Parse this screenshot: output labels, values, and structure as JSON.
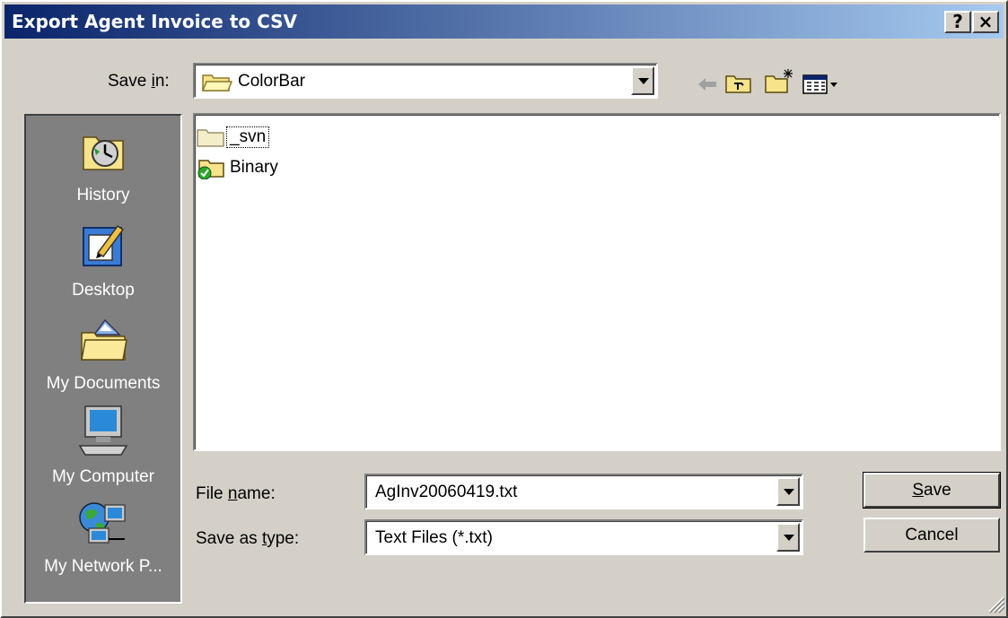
{
  "window": {
    "title": "Export Agent Invoice to CSV",
    "help_glyph": "?",
    "close_glyph": "×"
  },
  "save_in": {
    "label": "Save in:",
    "value": "ColorBar"
  },
  "places": [
    {
      "label": "History",
      "icon": "history-icon"
    },
    {
      "label": "Desktop",
      "icon": "desktop-icon"
    },
    {
      "label": "My Documents",
      "icon": "my-documents-icon"
    },
    {
      "label": "My Computer",
      "icon": "my-computer-icon"
    },
    {
      "label": "My Network P...",
      "icon": "my-network-places-icon"
    }
  ],
  "files": [
    {
      "name": "_svn",
      "icon": "folder-icon",
      "focused": true
    },
    {
      "name": "Binary",
      "icon": "folder-svn-icon",
      "focused": false
    }
  ],
  "file_name": {
    "label": "File name:",
    "value": "AgInv20060419.txt"
  },
  "save_as_type": {
    "label": "Save as type:",
    "value": "Text Files (*.txt)"
  },
  "buttons": {
    "save": "Save",
    "cancel": "Cancel"
  },
  "toolbar": {
    "back": "back-arrow-icon",
    "up": "up-folder-icon",
    "new_folder": "new-folder-icon",
    "views": "view-menu-icon"
  },
  "colors": {
    "title_start": "#0a246a",
    "title_end": "#a6caf0",
    "face": "#d4d0c8",
    "places_bg": "#808080"
  }
}
